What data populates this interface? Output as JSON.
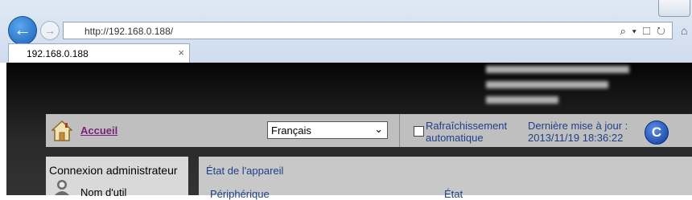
{
  "browser": {
    "url": "http://192.168.0.188/",
    "tab_title": "192.168.0.188",
    "tab_close": "×",
    "back_glyph": "←",
    "forward_glyph": "→",
    "addr_icons": "⌕ ▾ ☐ ↻"
  },
  "toolbar": {
    "home_label": "Accueil",
    "language": {
      "selected": "Français"
    },
    "auto_refresh_label": "Rafraîchissement automatique",
    "auto_refresh_checked": false,
    "last_update_label": "Dernière mise à jour :",
    "last_update_value": "2013/11/19 18:36:22",
    "refresh_glyph": "C"
  },
  "sidebar": {
    "title": "Connexion administrateur",
    "username_label": "Nom d'util"
  },
  "main": {
    "section_title": "État de l'appareil",
    "columns": [
      "Périphérique",
      "État"
    ]
  },
  "colors": {
    "link": "#7a1f7a",
    "label_blue": "#1f3f8a",
    "toolbar_bg": "#bfbfbf",
    "header_bg": "#050505"
  }
}
